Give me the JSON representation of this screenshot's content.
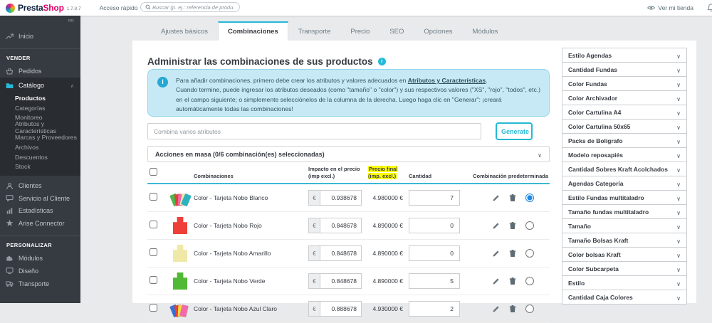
{
  "colors": {
    "accent": "#25b9d7",
    "brand_navy": "#0b1f3f",
    "brand_pink": "#df0067",
    "sidebar_bg": "#363a41",
    "alert_bg": "#c7e9f5",
    "header_highlight": "#ffff00",
    "selected_radio": "#1e88e5"
  },
  "topbar": {
    "brand_presta": "Presta",
    "brand_shop": "Shop",
    "version": "1.7.8.7",
    "quick_access": "Acceso rápido",
    "search_placeholder": "Buscar (p. ej.: referencia de producto,",
    "view_shop": "Ver mi tienda"
  },
  "sidebar": {
    "home_label": "Inicio",
    "sell_header": "VENDER",
    "orders_label": "Pedidos",
    "catalog_label": "Catálogo",
    "catalog_sub": [
      "Productos",
      "Categorías",
      "Monitoreo",
      "Atributos y Características",
      "Marcas y Proveedores",
      "Archivos",
      "Descuentos",
      "Stock"
    ],
    "customers_label": "Clientes",
    "service_label": "Servicio al Cliente",
    "stats_label": "Estadísticas",
    "arise_label": "Arise Connector",
    "personalize_header": "PERSONALIZAR",
    "modules_label": "Módulos",
    "design_label": "Diseño",
    "shipping_label": "Transporte"
  },
  "tabs": [
    "Ajustes básicos",
    "Combinaciones",
    "Transporte",
    "Precio",
    "SEO",
    "Opciones",
    "Módulos"
  ],
  "main": {
    "title": "Administrar las combinaciones de sus productos",
    "alert": {
      "line1_pre": "Para añadir combinaciones, primero debe crear los atributos y valores adecuados en ",
      "link": "Atributos y Características",
      "line1_post": ".",
      "line2": "Cuando termine, puede ingresar los atributos deseados (como \"tamaño\" o \"color\") y sus respectivos valores (\"XS\", \"rojo\", \"todos\", etc.) en el campo siguiente; o simplemente selecciónelos de la columna de la derecha. Luego haga clic en \"Generar\": ¡creará automáticamente todas las combinaciones!"
    },
    "combine_placeholder": "Combina varios atributos",
    "generate_label": "Generate",
    "bulk_actions": "Acciones en masa (0/6 combinación(es) seleccionadas)"
  },
  "table": {
    "currency": "€",
    "headers": {
      "combinations": "Combinaciones",
      "impact": "Impacto en el precio (imp excl.)",
      "final_price": "Precio final (imp. excl.)",
      "quantity": "Cantidad",
      "default": "Combinación predeterminada"
    },
    "rows": [
      {
        "label": "Color - Tarjeta Nobo Blanco",
        "impact": "0.938678",
        "final": "4.980000 €",
        "qty": "7",
        "image_colors": [
          "#4db848",
          "#e8413c",
          "#f06ba8",
          "#f2e6b0",
          "#2bb3c0"
        ]
      },
      {
        "label": "Color - Tarjeta Nobo Rojo",
        "impact": "0.848678",
        "final": "4.890000 €",
        "qty": "0",
        "image_colors": [
          "#ee4038"
        ]
      },
      {
        "label": "Color - Tarjeta Nobo Amarillo",
        "impact": "0.848678",
        "final": "4.890000 €",
        "qty": "0",
        "image_colors": [
          "#f0e8a6"
        ]
      },
      {
        "label": "Color - Tarjeta Nobo Verde",
        "impact": "0.848678",
        "final": "4.890000 €",
        "qty": "5",
        "image_colors": [
          "#52b935"
        ]
      },
      {
        "label": "Color - Tarjeta Nobo Azul Claro",
        "impact": "0.888678",
        "final": "4.930000 €",
        "qty": "2",
        "image_colors": [
          "#3b6fd4",
          "#e8413c",
          "#f5d93f",
          "#f06ba8"
        ]
      }
    ]
  },
  "attributes_panel": {
    "items": [
      "Estilo Agendas",
      "Cantidad Fundas",
      "Color Fundas",
      "Color Archivador",
      "Color Cartulina A4",
      "Color Cartulina 50x65",
      "Packs de Bolígrafo",
      "Modelo reposapiés",
      "Cantidad Sobres Kraft Acolchados",
      "Agendas Categoría",
      "Estilo Fundas multitaladro",
      "Tamaño fundas multitaladro",
      "Tamaño",
      "Tamaño Bolsas Kraft",
      "Color bolsas Kraft",
      "Color Subcarpeta",
      "Estilo",
      "Cantidad Caja Colores"
    ]
  }
}
